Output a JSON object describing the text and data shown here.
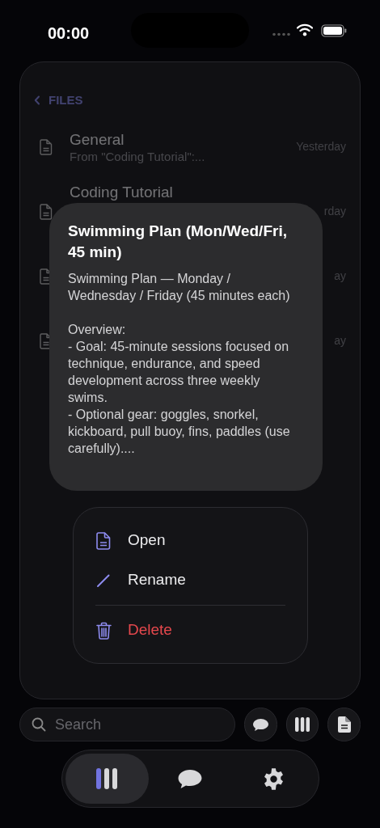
{
  "status_bar": {
    "time": "00:00"
  },
  "back_link": {
    "label": "FILES"
  },
  "files": [
    {
      "title": "General",
      "subtitle": "From \"Coding Tutorial\":...",
      "date": "Yesterday"
    },
    {
      "title": "Coding Tutorial",
      "date": "rday"
    },
    {
      "date": "ay"
    },
    {
      "date": "ay"
    }
  ],
  "preview": {
    "title": "Swimming Plan (Mon/Wed/Fri, 45 min)",
    "body": "Swimming Plan — Monday / Wednesday / Friday (45 minutes each)\n\nOverview:\n- Goal: 45-minute sessions focused on technique, endurance, and speed development across three weekly swims.\n- Optional gear: goggles, snorkel, kickboard, pull buoy, fins, paddles (use carefully)...."
  },
  "context_menu": [
    {
      "label": "Open",
      "kind": "open"
    },
    {
      "label": "Rename",
      "kind": "rename"
    },
    {
      "label": "Delete",
      "kind": "delete"
    }
  ],
  "search": {
    "placeholder": "Search"
  },
  "tabs": [
    {
      "kind": "library",
      "selected": true
    },
    {
      "kind": "chat",
      "selected": false
    },
    {
      "kind": "settings",
      "selected": false
    }
  ]
}
